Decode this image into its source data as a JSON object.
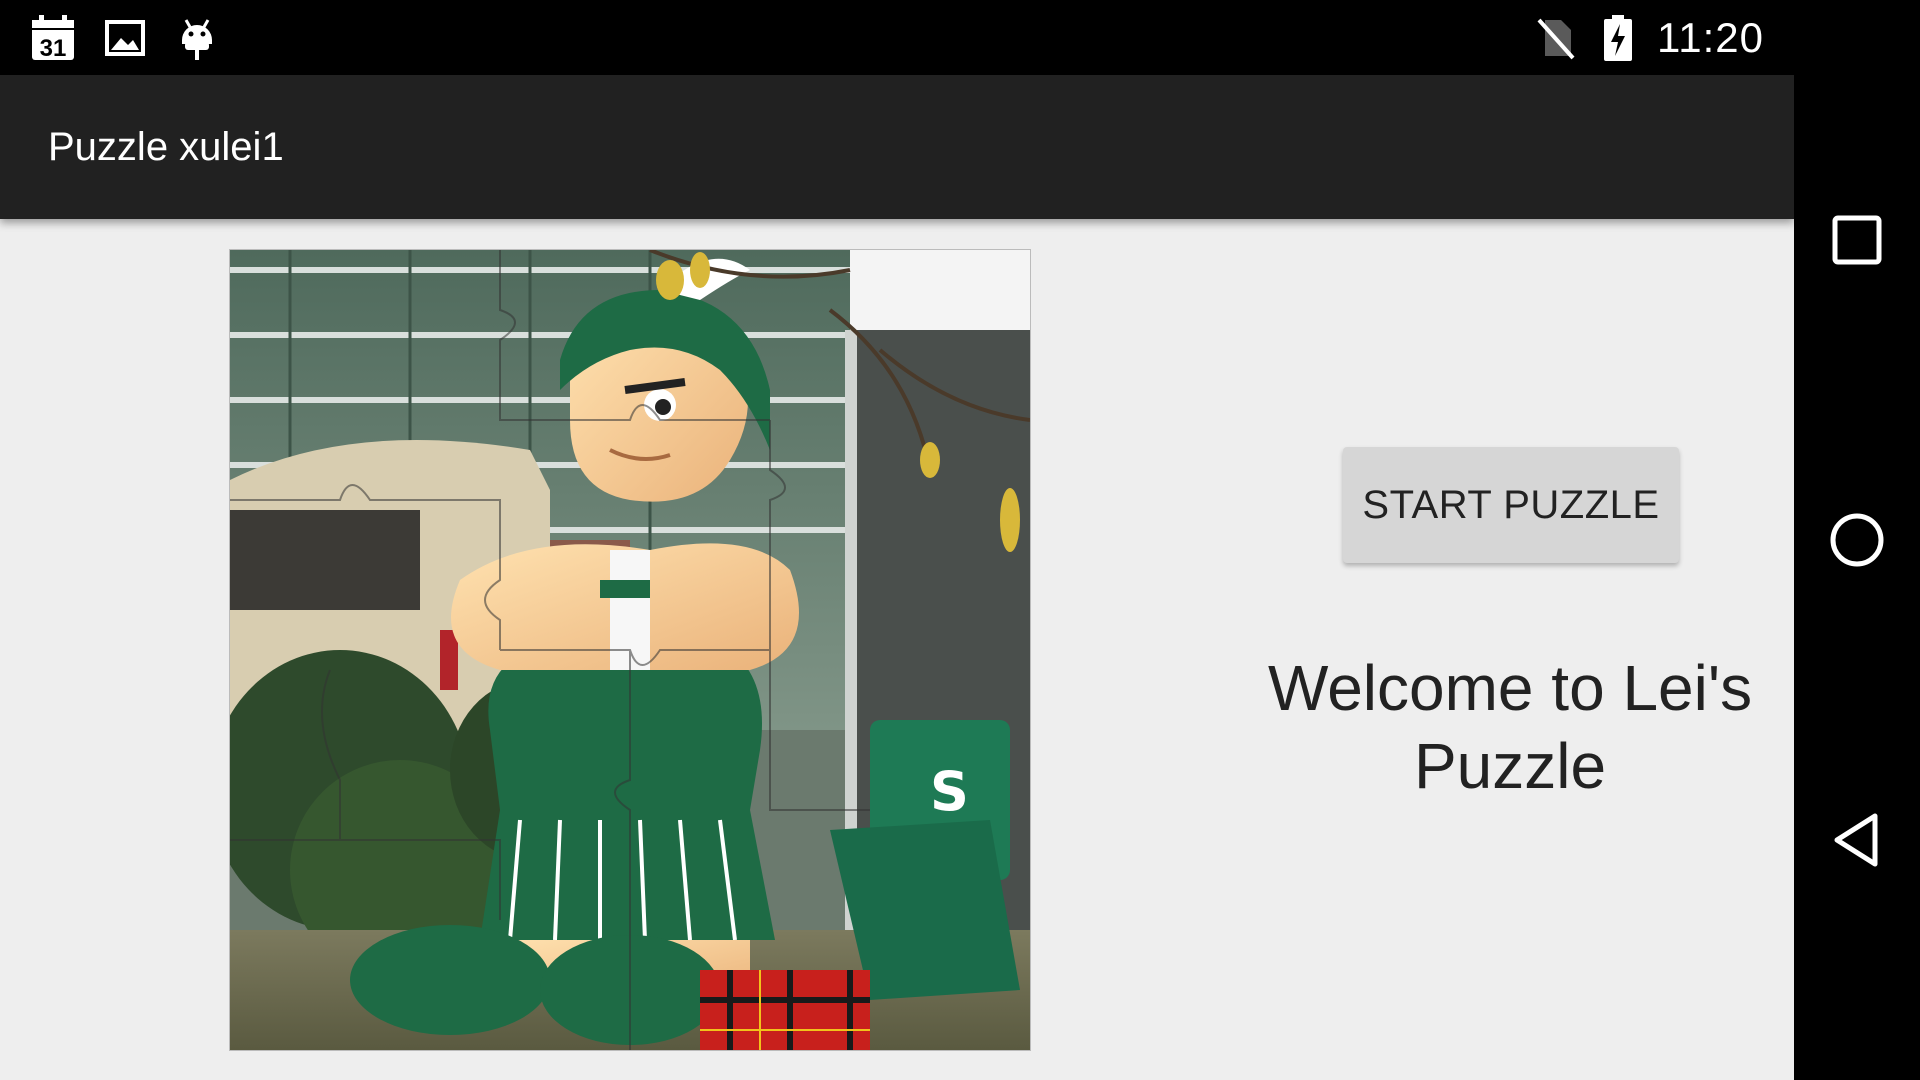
{
  "status_bar": {
    "left_icons": [
      "calendar-icon",
      "image-icon",
      "android-debug-icon"
    ],
    "calendar_day": "31",
    "right_icons": [
      "no-sim-icon",
      "battery-charging-icon"
    ],
    "time": "11:20"
  },
  "app_bar": {
    "title": "Puzzle xulei1"
  },
  "main": {
    "start_button_label": "START PUZZLE",
    "welcome_text": "Welcome to Lei's Puzzle"
  },
  "nav_bar": {
    "buttons": [
      "recents-icon",
      "home-icon",
      "back-icon"
    ]
  },
  "colors": {
    "status_bar_bg": "#000000",
    "app_bar_bg": "#212121",
    "content_bg": "#eeeeee",
    "button_bg": "#d6d6d6",
    "spartan_green": "#1e6b45",
    "spartan_skin": "#f4c990"
  }
}
